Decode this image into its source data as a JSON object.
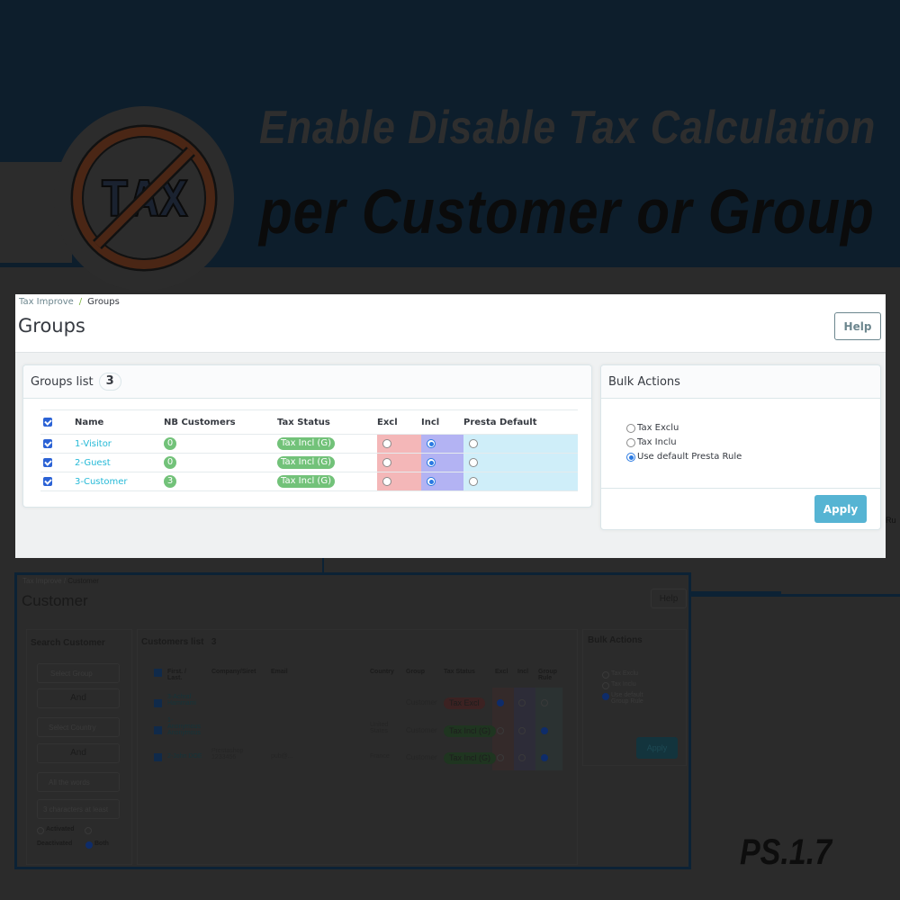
{
  "hero": {
    "title_line1": "Enable Disable Tax Calculation",
    "title_line2": "per Customer or Group",
    "logo_text": "TAX",
    "version_label": "PS.1.7"
  },
  "groups_page": {
    "breadcrumb": {
      "parent": "Tax Improve",
      "separator": "/",
      "current": "Groups"
    },
    "title": "Groups",
    "help_label": "Help",
    "groups_list": {
      "title": "Groups list",
      "count": "3",
      "columns": [
        "Name",
        "NB Customers",
        "Tax Status",
        "Excl",
        "Incl",
        "Presta Default"
      ],
      "rows": [
        {
          "checked": true,
          "name": "1-Visitor",
          "nb_customers": "0",
          "tax_status": "Tax Incl (G)",
          "selected": "incl"
        },
        {
          "checked": true,
          "name": "2-Guest",
          "nb_customers": "0",
          "tax_status": "Tax Incl (G)",
          "selected": "incl"
        },
        {
          "checked": true,
          "name": "3-Customer",
          "nb_customers": "3",
          "tax_status": "Tax Incl (G)",
          "selected": "incl"
        }
      ]
    },
    "bulk_actions": {
      "title": "Bulk Actions",
      "options": [
        {
          "label": "Tax Exclu",
          "selected": false
        },
        {
          "label": "Tax Inclu",
          "selected": false
        },
        {
          "label": "Use default Presta Rule",
          "selected": true
        }
      ],
      "apply_label": "Apply"
    },
    "edge_text": "Ru"
  },
  "customer_page": {
    "breadcrumb": {
      "parent": "Tax Improve",
      "separator": "/",
      "current": "Customer"
    },
    "title": "Customer",
    "help_label": "Help",
    "search": {
      "title": "Search Customer",
      "select_group": "Select Group",
      "and_1": "And",
      "select_country": "Select Country",
      "and_2": "And",
      "words_mode": "All the words",
      "text_placeholder": "3 characters at least",
      "status_activated": "Activated",
      "status_deactivated": "Deactivated",
      "status_both": "Both",
      "status_selected": "Both"
    },
    "customers_list": {
      "title": "Customers list",
      "count": "3",
      "columns": [
        "First. / Last.",
        "Company/Siret",
        "Email",
        "Country",
        "Group",
        "Tax Status",
        "Excl",
        "Incl",
        "Group Rule"
      ],
      "rows": [
        {
          "name": "3-Achraf Hammami",
          "company": "",
          "email": "",
          "country": "",
          "group": "Customer",
          "tax_status": "Tax Excl",
          "selected": "excl"
        },
        {
          "name": "1-Anonymous Anonymous",
          "company": "",
          "email": "",
          "country": "United States",
          "group": "Customer",
          "tax_status": "Tax Incl (G)",
          "selected": "group"
        },
        {
          "name": "2-John DOE",
          "company": "Prestashop 1233456",
          "email": "pub@...",
          "country": "France",
          "group": "Customer",
          "tax_status": "Tax Incl (G)",
          "selected": "group"
        }
      ]
    },
    "bulk_actions": {
      "title": "Bulk Actions",
      "options": [
        {
          "label": "Tax Exclu",
          "selected": false
        },
        {
          "label": "Tax Inclu",
          "selected": false
        },
        {
          "label": "Use default Group Rule",
          "selected": true
        }
      ],
      "apply_label": "Apply"
    }
  },
  "colors": {
    "banner_bg": "#0d1e2c",
    "dim_bg": "#2b2b2b",
    "excl_col": "#f4b7b8",
    "incl_col": "#b3b3f3",
    "default_col": "#cfeef9",
    "badge_green": "#72c279",
    "link": "#25b9d7",
    "apply_button": "#56b4d3"
  }
}
